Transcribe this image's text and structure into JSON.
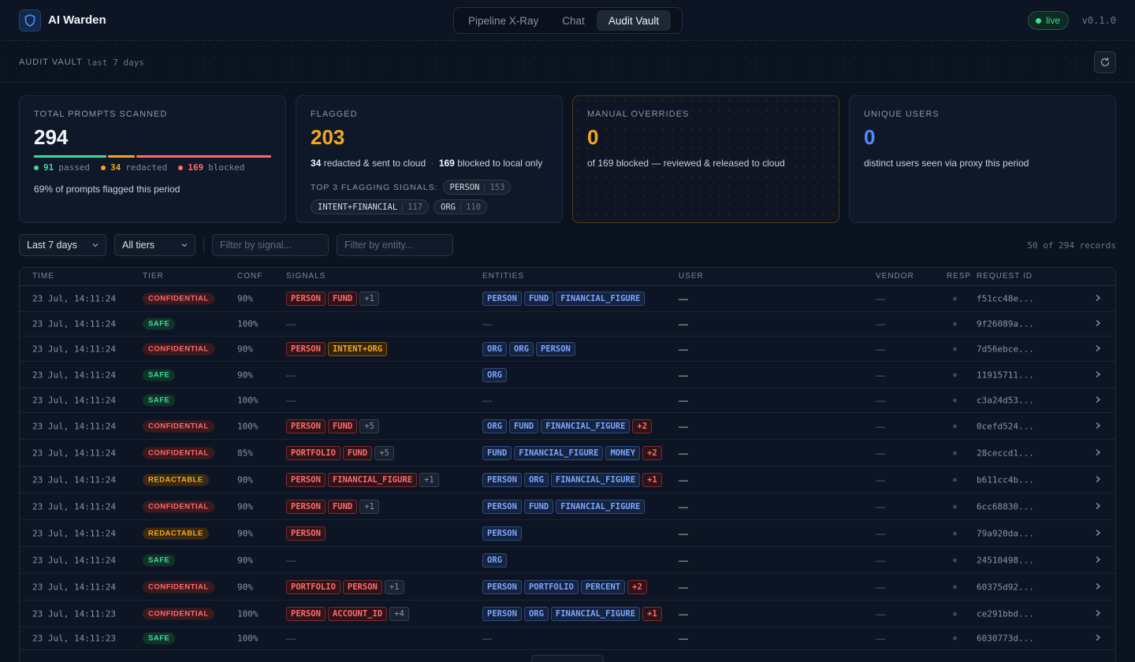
{
  "app": {
    "title": "AI Warden",
    "version": "v0.1.0",
    "status": "live"
  },
  "nav": {
    "tabs": [
      {
        "label": "Pipeline X-Ray",
        "active": false
      },
      {
        "label": "Chat",
        "active": false
      },
      {
        "label": "Audit Vault",
        "active": true
      }
    ]
  },
  "page": {
    "title": "AUDIT VAULT",
    "range": "last 7 days"
  },
  "stats": {
    "total": {
      "label": "TOTAL PROMPTS SCANNED",
      "value": "294",
      "passed": "91",
      "passed_label": "passed",
      "redacted": "34",
      "redacted_label": "redacted",
      "blocked": "169",
      "blocked_label": "blocked",
      "flagged_note": "69% of prompts flagged this period"
    },
    "flagged": {
      "label": "FLAGGED",
      "value": "203",
      "redacted_count": "34",
      "redacted_text": "redacted & sent to cloud",
      "separator": "·",
      "blocked_count": "169",
      "blocked_text": "blocked to local only",
      "signals_label": "TOP 3 FLAGGING SIGNALS:",
      "signals": [
        {
          "name": "PERSON",
          "count": "153"
        },
        {
          "name": "INTENT+FINANCIAL",
          "count": "117"
        },
        {
          "name": "ORG",
          "count": "110"
        }
      ]
    },
    "overrides": {
      "label": "MANUAL OVERRIDES",
      "value": "0",
      "note": "of 169 blocked — reviewed & released to cloud"
    },
    "users": {
      "label": "UNIQUE USERS",
      "value": "0",
      "note": "distinct users seen via proxy this period"
    }
  },
  "filters": {
    "range": "Last 7 days",
    "tier": "All tiers",
    "signal_placeholder": "Filter by signal...",
    "entity_placeholder": "Filter by entity...",
    "records": "50 of 294 records"
  },
  "table": {
    "columns": [
      "TIME",
      "TIER",
      "CONF",
      "SIGNALS",
      "ENTITIES",
      "USER",
      "VENDOR",
      "RESP",
      "REQUEST ID"
    ],
    "rows": [
      {
        "time": "23 Jul, 14:11:24",
        "tier": "CONFIDENTIAL",
        "conf": "90%",
        "signals": [
          "PERSON",
          "FUND"
        ],
        "signals_more": "+1",
        "entities": [
          "PERSON",
          "FUND",
          "FINANCIAL_FIGURE"
        ],
        "entities_more": "",
        "user": "—",
        "vendor": "—",
        "request_id": "f51cc48e..."
      },
      {
        "time": "23 Jul, 14:11:24",
        "tier": "SAFE",
        "conf": "100%",
        "signals": [],
        "signals_more": "",
        "entities": [],
        "entities_more": "",
        "user": "—",
        "vendor": "—",
        "request_id": "9f26089a..."
      },
      {
        "time": "23 Jul, 14:11:24",
        "tier": "CONFIDENTIAL",
        "conf": "90%",
        "signals": [
          "PERSON",
          "INTENT+ORG"
        ],
        "signals_more": "",
        "entities": [
          "ORG",
          "ORG",
          "PERSON"
        ],
        "entities_more": "",
        "user": "—",
        "vendor": "—",
        "request_id": "7d56ebce..."
      },
      {
        "time": "23 Jul, 14:11:24",
        "tier": "SAFE",
        "conf": "90%",
        "signals": [],
        "signals_more": "",
        "entities": [
          "ORG"
        ],
        "entities_more": "",
        "user": "—",
        "vendor": "—",
        "request_id": "11915711..."
      },
      {
        "time": "23 Jul, 14:11:24",
        "tier": "SAFE",
        "conf": "100%",
        "signals": [],
        "signals_more": "",
        "entities": [],
        "entities_more": "",
        "user": "—",
        "vendor": "—",
        "request_id": "c3a24d53..."
      },
      {
        "time": "23 Jul, 14:11:24",
        "tier": "CONFIDENTIAL",
        "conf": "100%",
        "signals": [
          "PERSON",
          "FUND"
        ],
        "signals_more": "+5",
        "entities": [
          "ORG",
          "FUND",
          "FINANCIAL_FIGURE"
        ],
        "entities_more": "+2",
        "user": "—",
        "vendor": "—",
        "request_id": "0cefd524..."
      },
      {
        "time": "23 Jul, 14:11:24",
        "tier": "CONFIDENTIAL",
        "conf": "85%",
        "signals": [
          "PORTFOLIO",
          "FUND"
        ],
        "signals_more": "+5",
        "entities": [
          "FUND",
          "FINANCIAL_FIGURE",
          "MONEY"
        ],
        "entities_more": "+2",
        "user": "—",
        "vendor": "—",
        "request_id": "28ceccd1..."
      },
      {
        "time": "23 Jul, 14:11:24",
        "tier": "REDACTABLE",
        "conf": "90%",
        "signals": [
          "PERSON",
          "FINANCIAL_FIGURE"
        ],
        "signals_more": "+1",
        "entities": [
          "PERSON",
          "ORG",
          "FINANCIAL_FIGURE"
        ],
        "entities_more": "+1",
        "user": "—",
        "vendor": "—",
        "request_id": "b611cc4b..."
      },
      {
        "time": "23 Jul, 14:11:24",
        "tier": "CONFIDENTIAL",
        "conf": "90%",
        "signals": [
          "PERSON",
          "FUND"
        ],
        "signals_more": "+1",
        "entities": [
          "PERSON",
          "FUND",
          "FINANCIAL_FIGURE"
        ],
        "entities_more": "",
        "user": "—",
        "vendor": "—",
        "request_id": "6cc68830..."
      },
      {
        "time": "23 Jul, 14:11:24",
        "tier": "REDACTABLE",
        "conf": "90%",
        "signals": [
          "PERSON"
        ],
        "signals_more": "",
        "entities": [
          "PERSON"
        ],
        "entities_more": "",
        "user": "—",
        "vendor": "—",
        "request_id": "79a920da..."
      },
      {
        "time": "23 Jul, 14:11:24",
        "tier": "SAFE",
        "conf": "90%",
        "signals": [],
        "signals_more": "",
        "entities": [
          "ORG"
        ],
        "entities_more": "",
        "user": "—",
        "vendor": "—",
        "request_id": "24510498..."
      },
      {
        "time": "23 Jul, 14:11:24",
        "tier": "CONFIDENTIAL",
        "conf": "90%",
        "signals": [
          "PORTFOLIO",
          "PERSON"
        ],
        "signals_more": "+1",
        "entities": [
          "PERSON",
          "PORTFOLIO",
          "PERCENT"
        ],
        "entities_more": "+2",
        "user": "—",
        "vendor": "—",
        "request_id": "60375d92..."
      },
      {
        "time": "23 Jul, 14:11:23",
        "tier": "CONFIDENTIAL",
        "conf": "100%",
        "signals": [
          "PERSON",
          "ACCOUNT_ID"
        ],
        "signals_more": "+4",
        "entities": [
          "PERSON",
          "ORG",
          "FINANCIAL_FIGURE"
        ],
        "entities_more": "+1",
        "user": "—",
        "vendor": "—",
        "request_id": "ce291bbd..."
      },
      {
        "time": "23 Jul, 14:11:23",
        "tier": "SAFE",
        "conf": "100%",
        "signals": [],
        "signals_more": "",
        "entities": [],
        "entities_more": "",
        "user": "—",
        "vendor": "—",
        "request_id": "6030773d..."
      }
    ]
  },
  "colors": {
    "passed": "#3ddc97",
    "redacted": "#f5a623",
    "blocked": "#ff6b6b",
    "flagged_value": "#f5a623",
    "overrides_value": "#f5a623",
    "users_value": "#4d8dff"
  }
}
